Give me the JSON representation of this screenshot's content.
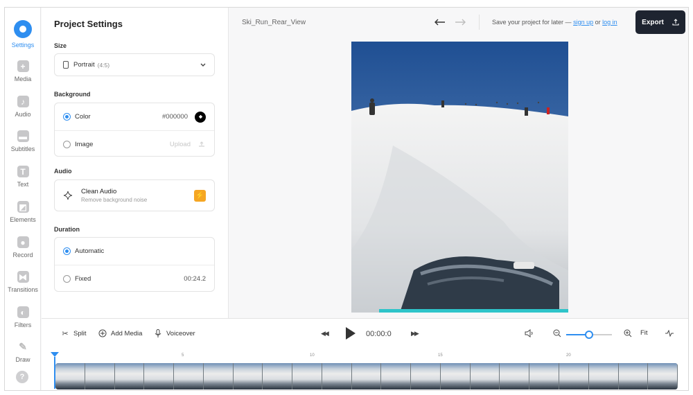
{
  "rail": {
    "items": [
      {
        "label": "Settings",
        "icon": "settings-icon",
        "glyph": "",
        "active": true
      },
      {
        "label": "Media",
        "icon": "plus-icon",
        "glyph": "+"
      },
      {
        "label": "Audio",
        "icon": "music-note-icon",
        "glyph": "♪"
      },
      {
        "label": "Subtitles",
        "icon": "subtitles-icon",
        "glyph": "▬"
      },
      {
        "label": "Text",
        "icon": "text-icon",
        "glyph": "T"
      },
      {
        "label": "Elements",
        "icon": "elements-icon",
        "glyph": "◩"
      },
      {
        "label": "Record",
        "icon": "record-icon",
        "glyph": "●"
      },
      {
        "label": "Transitions",
        "icon": "transitions-icon",
        "glyph": "⧓"
      },
      {
        "label": "Filters",
        "icon": "filters-icon",
        "glyph": "◐"
      },
      {
        "label": "Draw",
        "icon": "pencil-icon",
        "glyph": "✎"
      }
    ],
    "help_glyph": "?"
  },
  "panel": {
    "title": "Project Settings",
    "size": {
      "label": "Size",
      "value": "Portrait",
      "ratio": "(4:5)"
    },
    "background": {
      "label": "Background",
      "color_option": "Color",
      "color_value": "#000000",
      "image_option": "Image",
      "upload_label": "Upload"
    },
    "audio": {
      "label": "Audio",
      "title": "Clean Audio",
      "subtitle": "Remove background noise"
    },
    "duration": {
      "label": "Duration",
      "automatic_option": "Automatic",
      "fixed_option": "Fixed",
      "fixed_value": "00:24.2"
    }
  },
  "topbar": {
    "project_name": "Ski_Run_Rear_View",
    "save_text": "Save your project for later —",
    "sign_up": "sign up",
    "or": "or",
    "log_in": "log in",
    "export_label": "Export"
  },
  "timeline": {
    "split_label": "Split",
    "add_media_label": "Add Media",
    "voiceover_label": "Voiceover",
    "time": "00:00:0",
    "fit_label": "Fit",
    "zoom_level": 0.5,
    "ruler_ticks": [
      "5",
      "10",
      "15",
      "20"
    ],
    "frame_count": 21
  },
  "colors": {
    "accent": "#2e8ef0",
    "export_bg": "#1e2430",
    "bolt": "#f5a623"
  }
}
